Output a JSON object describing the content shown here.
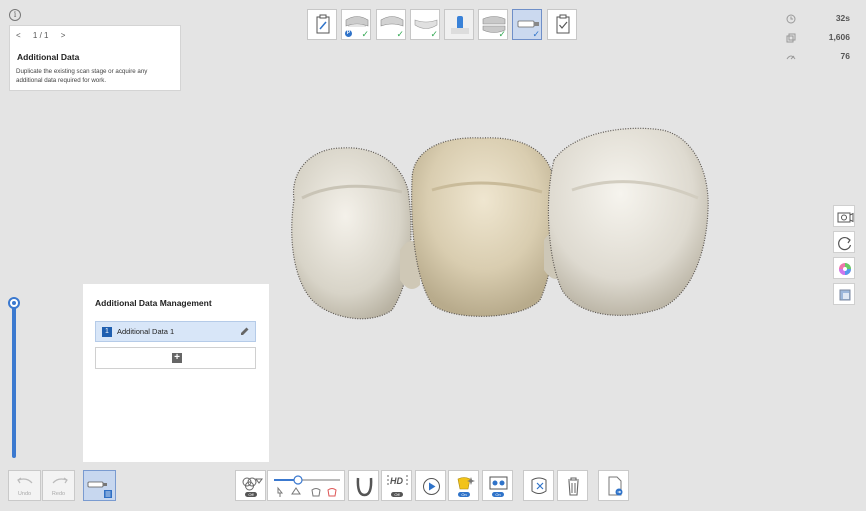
{
  "guide": {
    "prev": "<",
    "page": "1 / 1",
    "next": ">",
    "title": "Additional Data",
    "description": "Duplicate the existing scan stage or acquire any additional data required for work."
  },
  "stats": {
    "time": "32s",
    "frames": "1,606",
    "percent": "76"
  },
  "panel": {
    "title": "Additional Data Management",
    "items": [
      {
        "number": "1",
        "label": "Additional Data 1"
      }
    ]
  },
  "toolbar": {
    "undo": "Undo",
    "redo": "Redo",
    "off1": "Off",
    "hd": "HD",
    "off2": "Off",
    "on1": "On",
    "on2": "On"
  }
}
